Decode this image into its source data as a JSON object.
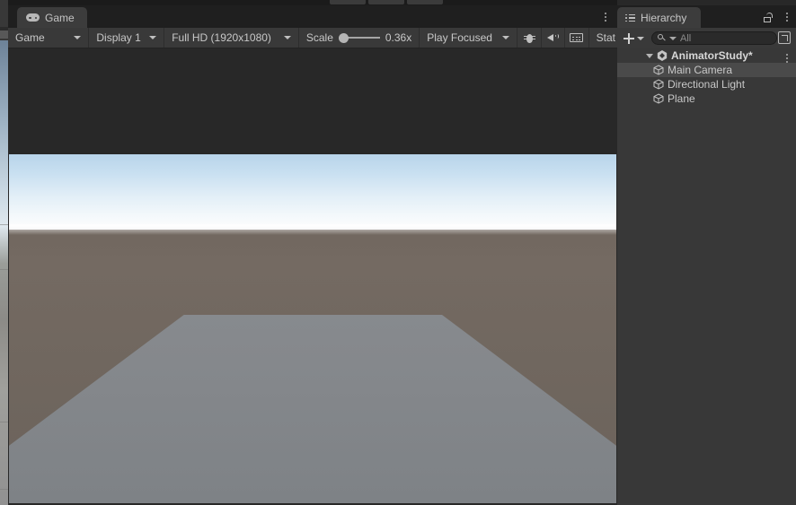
{
  "window": {
    "background": "#1b1b1b"
  },
  "game_panel": {
    "tab": {
      "label": "Game",
      "icon": "gamepad-icon"
    },
    "tab_menu_icon": "kebab-menu-icon",
    "toolbar": {
      "view_mode": "Game",
      "display": "Display 1",
      "resolution": "Full HD (1920x1080)",
      "scale_label": "Scale",
      "scale_value": "0.36x",
      "scale_percent": 12,
      "play_mode": "Play Focused",
      "mute_icon": "speaker-icon",
      "debug_icon": "bug-icon",
      "gizmos_icon": "keyboard-icon",
      "stats_label": "Stat"
    },
    "render": {
      "sky_top_color": "#b8d4ea",
      "sky_horizon_color": "#fbfcfd",
      "ground_color": "#71675f",
      "plane_color": "#8f9296"
    }
  },
  "hierarchy": {
    "tab": {
      "label": "Hierarchy",
      "icon": "hierarchy-icon"
    },
    "lock_icon": "lock-open-icon",
    "menu_icon": "kebab-menu-icon",
    "toolbar": {
      "add_label": "+",
      "search_placeholder": "All",
      "search_value": ""
    },
    "tree": [
      {
        "label": "AnimatorStudy*",
        "type": "scene",
        "depth": 0,
        "expanded": true,
        "selected": false
      },
      {
        "label": "Main Camera",
        "type": "gameobject",
        "depth": 1,
        "expanded": false,
        "selected": true
      },
      {
        "label": "Directional Light",
        "type": "gameobject",
        "depth": 1,
        "expanded": false,
        "selected": false
      },
      {
        "label": "Plane",
        "type": "gameobject",
        "depth": 1,
        "expanded": false,
        "selected": false
      }
    ]
  },
  "scene_sliver": {
    "visible": true
  }
}
